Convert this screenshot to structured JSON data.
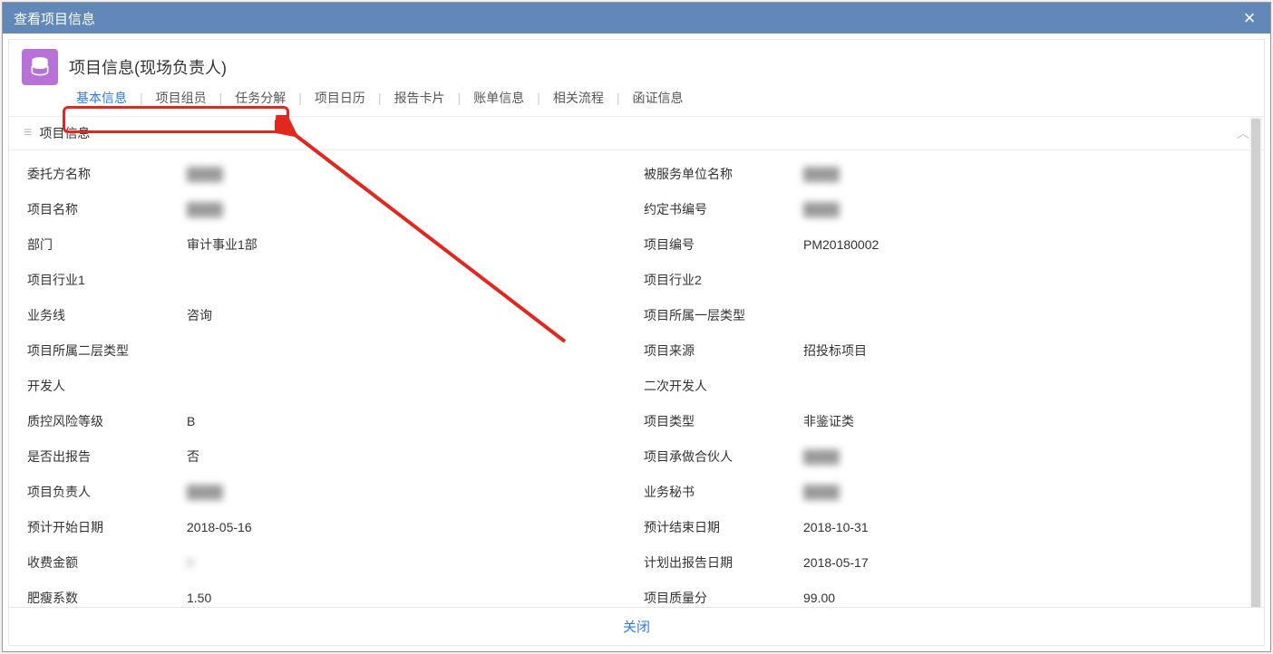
{
  "modal": {
    "title": "查看项目信息"
  },
  "header": {
    "page_title": "项目信息(现场负责人)"
  },
  "tabs": [
    {
      "label": "基本信息",
      "active": true
    },
    {
      "label": "项目组员",
      "active": false
    },
    {
      "label": "任务分解",
      "active": false
    },
    {
      "label": "项目日历",
      "active": false
    },
    {
      "label": "报告卡片",
      "active": false
    },
    {
      "label": "账单信息",
      "active": false
    },
    {
      "label": "相关流程",
      "active": false
    },
    {
      "label": "函证信息",
      "active": false
    }
  ],
  "section": {
    "title": "项目信息"
  },
  "fields": [
    {
      "label": "委托方名称",
      "value": "",
      "blurred": true
    },
    {
      "label": "被服务单位名称",
      "value": "",
      "blurred": true
    },
    {
      "label": "项目名称",
      "value": "",
      "blurred": true
    },
    {
      "label": "约定书编号",
      "value": "",
      "blurred": true
    },
    {
      "label": "部门",
      "value": "审计事业1部",
      "blurred": false
    },
    {
      "label": "项目编号",
      "value": "PM20180002",
      "blurred": false
    },
    {
      "label": "项目行业1",
      "value": "",
      "blurred": false
    },
    {
      "label": "项目行业2",
      "value": "",
      "blurred": false
    },
    {
      "label": "业务线",
      "value": "咨询",
      "blurred": false
    },
    {
      "label": "项目所属一层类型",
      "value": "",
      "blurred": false
    },
    {
      "label": "项目所属二层类型",
      "value": "",
      "blurred": false
    },
    {
      "label": "项目来源",
      "value": "招投标项目",
      "blurred": false
    },
    {
      "label": "开发人",
      "value": "",
      "blurred": false
    },
    {
      "label": "二次开发人",
      "value": "",
      "blurred": false
    },
    {
      "label": "质控风险等级",
      "value": "B",
      "blurred": false
    },
    {
      "label": "项目类型",
      "value": "非鉴证类",
      "blurred": false
    },
    {
      "label": "是否出报告",
      "value": "否",
      "blurred": false
    },
    {
      "label": "项目承做合伙人",
      "value": "",
      "blurred": true
    },
    {
      "label": "项目负责人",
      "value": "",
      "blurred": true
    },
    {
      "label": "业务秘书",
      "value": "",
      "blurred": true
    },
    {
      "label": "预计开始日期",
      "value": "2018-05-16",
      "blurred": false
    },
    {
      "label": "预计结束日期",
      "value": "2018-10-31",
      "blurred": false
    },
    {
      "label": "收费金额",
      "value": "8",
      "blurred": true
    },
    {
      "label": "计划出报告日期",
      "value": "2018-05-17",
      "blurred": false
    },
    {
      "label": "肥瘦系数",
      "value": "1.50",
      "blurred": false
    },
    {
      "label": "项目质量分",
      "value": "99.00",
      "blurred": false
    }
  ],
  "footer": {
    "close_label": "关闭"
  }
}
